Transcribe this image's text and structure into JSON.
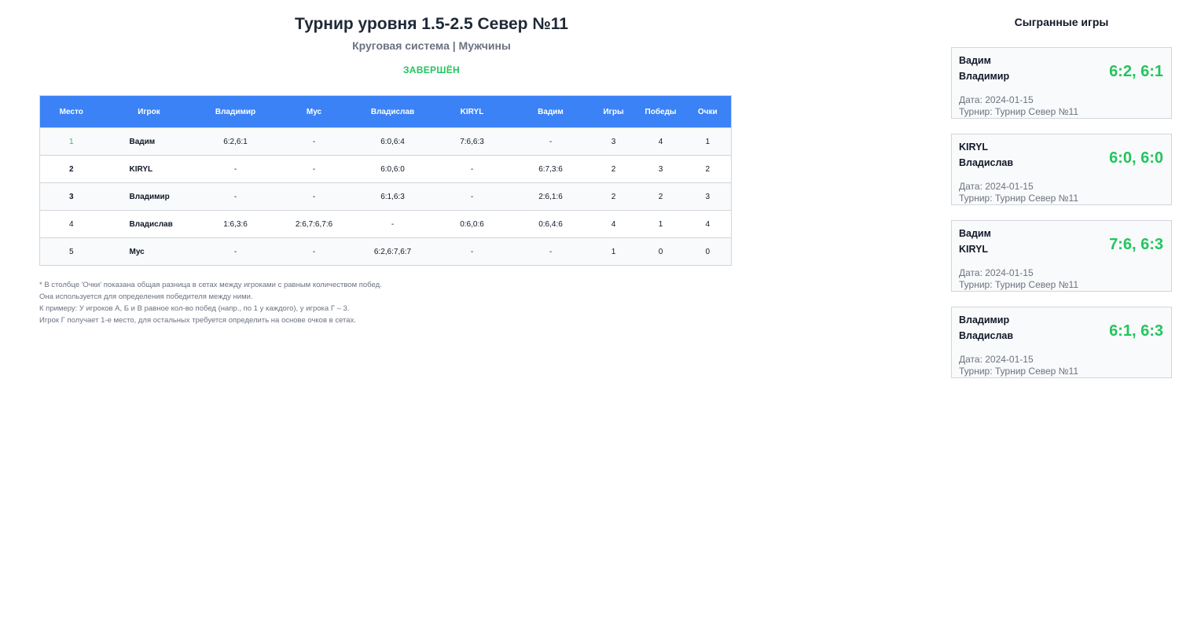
{
  "header": {
    "title": "Турнир уровня 1.5-2.5 Север №11",
    "subtitle": "Круговая система | Мужчины",
    "status": "ЗАВЕРШЁН"
  },
  "table": {
    "columns": [
      "Место",
      "Игрок",
      "Владимир",
      "Мус",
      "Владислав",
      "KIRYL",
      "Вадим",
      "Игры",
      "Победы",
      "Очки"
    ],
    "rows": [
      {
        "place": "1",
        "player": "Вадим",
        "vs": [
          "6:2,6:1",
          "-",
          "6:0,6:4",
          "7:6,6:3",
          "-"
        ],
        "games": "3",
        "wins": "4",
        "points": "1"
      },
      {
        "place": "2",
        "player": "KIRYL",
        "vs": [
          "-",
          "-",
          "6:0,6:0",
          "-",
          "6:7,3:6"
        ],
        "games": "2",
        "wins": "3",
        "points": "2"
      },
      {
        "place": "3",
        "player": "Владимир",
        "vs": [
          "-",
          "-",
          "6:1,6:3",
          "-",
          "2:6,1:6"
        ],
        "games": "2",
        "wins": "2",
        "points": "3"
      },
      {
        "place": "4",
        "player": "Владислав",
        "vs": [
          "1:6,3:6",
          "2:6,7:6,7:6",
          "-",
          "0:6,0:6",
          "0:6,4:6"
        ],
        "games": "4",
        "wins": "1",
        "points": "4"
      },
      {
        "place": "5",
        "player": "Мус",
        "vs": [
          "-",
          "-",
          "6:2,6:7,6:7",
          "-",
          "-"
        ],
        "games": "1",
        "wins": "0",
        "points": "0"
      }
    ]
  },
  "notes": [
    "* В столбце 'Очки' показана общая разница в сетах между игроками с равным количеством побед.",
    "Она используется для определения победителя между ними.",
    "К примеру: У игроков А, Б и В равное кол-во побед (напр., по 1 у каждого), у игрока Г – 3.",
    "Игрок Г получает 1-е место, для остальных требуется определить на основе очков в сетах."
  ],
  "sidebar": {
    "title": "Сыгранные игры",
    "games": [
      {
        "player1": "Вадим",
        "player2": "Владимир",
        "score": "6:2, 6:1",
        "date": "Дата: 2024-01-15",
        "tournament": "Турнир: Турнир Север №11"
      },
      {
        "player1": "KIRYL",
        "player2": "Владислав",
        "score": "6:0, 6:0",
        "date": "Дата: 2024-01-15",
        "tournament": "Турнир: Турнир Север №11"
      },
      {
        "player1": "Вадим",
        "player2": "KIRYL",
        "score": "7:6, 6:3",
        "date": "Дата: 2024-01-15",
        "tournament": "Турнир: Турнир Север №11"
      },
      {
        "player1": "Владимир",
        "player2": "Владислав",
        "score": "6:1, 6:3",
        "date": "Дата: 2024-01-15",
        "tournament": "Турнир: Турнир Север №11"
      }
    ]
  },
  "colors": {
    "header_blue": "#3b82f6",
    "accent_green": "#22c55e",
    "muted_gray": "#6b7280"
  }
}
